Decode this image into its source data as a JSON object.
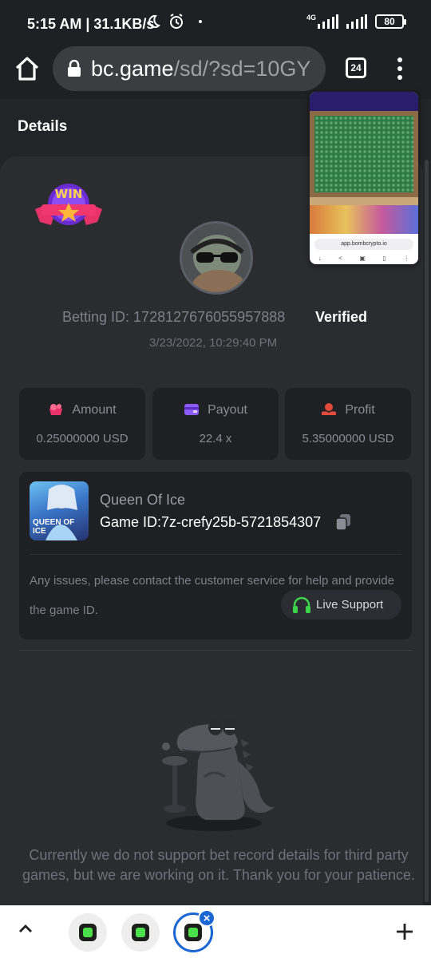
{
  "status_bar": {
    "time_speed": "5:15 AM | 31.1KB/s",
    "network": "4G",
    "battery": "80"
  },
  "browser": {
    "url_host": "bc.game",
    "url_path": "/sd/?sd=10GY",
    "tab_count": "24"
  },
  "page": {
    "title": "Details"
  },
  "bet": {
    "betting_id": "Betting ID: 1728127676055957888",
    "verified": "Verified",
    "date": "3/23/2022, 10:29:40 PM",
    "win_badge": "WIN"
  },
  "stats": [
    {
      "label": "Amount",
      "value": "0.25000000 USD",
      "icon": "coins-icon",
      "color": "#e8336a"
    },
    {
      "label": "Payout",
      "value": "22.4 x",
      "icon": "wallet-icon",
      "color": "#8b5cf6"
    },
    {
      "label": "Profit",
      "value": "5.35000000 USD",
      "icon": "hand-coins-icon",
      "color": "#e24a3b"
    }
  ],
  "game": {
    "name": "Queen Of Ice",
    "id": "Game ID:7z-crefy25b-5721854307",
    "thumb_label": "QUEEN OF ICE"
  },
  "support": {
    "help_text": "Any issues, please contact the customer service for help and provide the game ID.",
    "button_label": "Live Support"
  },
  "notice": "Currently we do not support bet record details for third party games, but we are working on it. Thank you for your patience.",
  "preview": {
    "url": "app.bombcrypto.io"
  },
  "colors": {
    "background": "#232427",
    "card": "#2b2c30",
    "accent_green": "#3cd44a",
    "tab_active": "#1a66d2"
  }
}
